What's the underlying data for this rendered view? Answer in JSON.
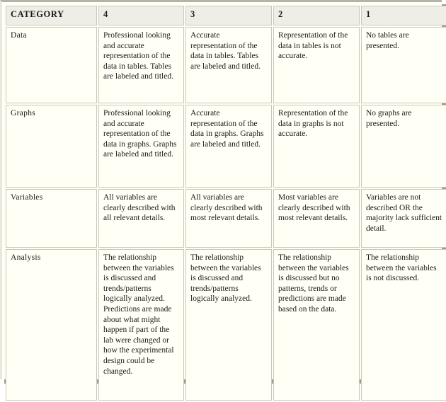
{
  "table": {
    "headers": [
      {
        "label": "CATEGORY",
        "name": "category"
      },
      {
        "label": "4",
        "name": "score-4"
      },
      {
        "label": "3",
        "name": "score-3"
      },
      {
        "label": "2",
        "name": "score-2"
      },
      {
        "label": "1",
        "name": "score-1"
      }
    ],
    "rows": [
      {
        "category": "Data",
        "score_4": "Professional looking and accurate representation of the data in tables. Tables are labeled and titled.",
        "score_3": "Accurate representation of the data in tables. Tables are labeled and titled.",
        "score_2": "Representation of the data in tables is not accurate.",
        "score_1": "No tables are presented."
      },
      {
        "category": "Graphs",
        "score_4": "Professional looking and accurate representation of the data in graphs. Graphs are labeled and titled.",
        "score_3": "Accurate representation of the data in graphs. Graphs are labeled and titled.",
        "score_2": "Representation of the data in graphs is not accurate.",
        "score_1": "No graphs are presented."
      },
      {
        "category": "Variables",
        "score_4": "All variables are clearly described with all relevant details.",
        "score_3": "All variables are clearly described with most relevant details.",
        "score_2": "Most variables are clearly described with most relevant details.",
        "score_1": "Variables are not described OR the majority lack sufficient detail."
      },
      {
        "category": "Analysis",
        "score_4": "The relationship between the variables is discussed and trends/patterns logically analyzed. Predictions are made about what might happen if part of the lab were changed or how the experimental design could be changed.",
        "score_3": "The relationship between the variables is discussed and trends/patterns logically analyzed.",
        "score_2": "The relationship between the variables is discussed but no patterns, trends or predictions are made based on the data.",
        "score_1": "The relationship between the variables is not discussed."
      }
    ]
  },
  "colors": {
    "header_background": "#eeeee6",
    "cell_background": "#fffff5",
    "border": "#c8c8be",
    "shadow": "#9c9c93",
    "text": "#1a1a1a"
  }
}
